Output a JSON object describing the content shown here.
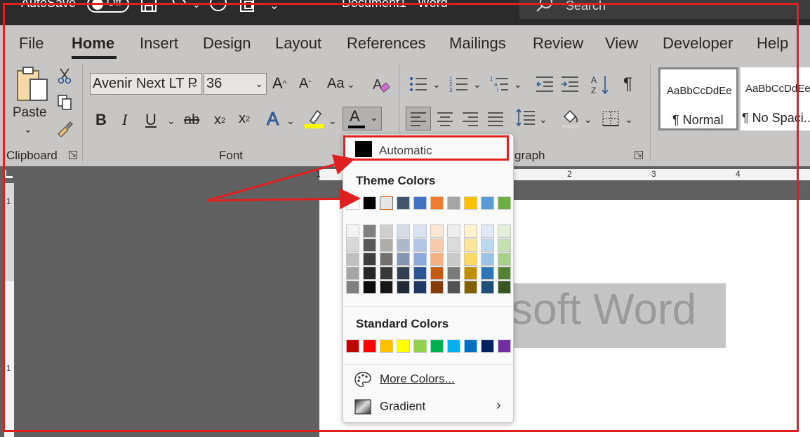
{
  "titlebar": {
    "autosave_label": "AutoSave",
    "autosave_state": "Off",
    "document_title": "Document1  -  Word",
    "search_label": "Search"
  },
  "tabs": [
    "File",
    "Home",
    "Insert",
    "Design",
    "Layout",
    "References",
    "Mailings",
    "Review",
    "View",
    "Developer",
    "Help"
  ],
  "active_tab": "Home",
  "clipboard": {
    "paste_label": "Paste",
    "group_label": "Clipboard"
  },
  "font": {
    "font_name": "Avenir Next LT P",
    "font_size": "36",
    "bold": "B",
    "italic": "I",
    "underline": "U",
    "strike": "ab",
    "subscript": "x",
    "superscript": "x",
    "change_case": "Aa",
    "font_color_glyph": "A",
    "group_label": "Font"
  },
  "paragraph": {
    "group_label": "graph"
  },
  "styles": [
    {
      "sample": "AaBbCcDdEe",
      "name": "¶ Normal"
    },
    {
      "sample": "AaBbCcDdEe",
      "name": "¶ No Spaci..."
    }
  ],
  "ruler": {
    "marks": [
      "1",
      "1",
      "2",
      "3",
      "4"
    ],
    "left_marks": [
      "1",
      "1"
    ]
  },
  "document": {
    "visible_text": "soft Word"
  },
  "color_menu": {
    "automatic_label": "Automatic",
    "theme_heading": "Theme Colors",
    "standard_heading": "Standard Colors",
    "more_colors_label": "More Colors...",
    "gradient_label": "Gradient",
    "theme_colors": [
      "#ffffff",
      "#000000",
      "#e7e6e6",
      "#44546a",
      "#4472c4",
      "#ed7d31",
      "#a5a5a5",
      "#ffc000",
      "#5b9bd5",
      "#70ad47"
    ],
    "theme_shades": [
      [
        "#f2f2f2",
        "#7f7f7f",
        "#d0cece",
        "#d6dce4",
        "#d9e2f3",
        "#fbe5d5",
        "#ededed",
        "#fff2cc",
        "#deebf6",
        "#e2efd9"
      ],
      [
        "#d8d8d8",
        "#595959",
        "#aeabab",
        "#adb9ca",
        "#b4c6e7",
        "#f7cbac",
        "#dbdbdb",
        "#fee599",
        "#bdd7ee",
        "#c5e0b3"
      ],
      [
        "#bfbfbf",
        "#3f3f3f",
        "#757070",
        "#8496b0",
        "#8eaadb",
        "#f4b183",
        "#c9c9c9",
        "#ffd965",
        "#9cc3e5",
        "#a8d08d"
      ],
      [
        "#a5a5a5",
        "#262626",
        "#3a3838",
        "#323f4f",
        "#2f5496",
        "#c55a11",
        "#7b7b7b",
        "#bf8f00",
        "#2e75b5",
        "#538135"
      ],
      [
        "#7f7f7f",
        "#0c0c0c",
        "#171616",
        "#222a35",
        "#1f3864",
        "#843c0b",
        "#525252",
        "#7f6000",
        "#1e4e79",
        "#375623"
      ]
    ],
    "standard_colors": [
      "#c00000",
      "#ff0000",
      "#ffc000",
      "#ffff00",
      "#92d050",
      "#00b050",
      "#00b0f0",
      "#0070c0",
      "#002060",
      "#7030a0"
    ]
  }
}
